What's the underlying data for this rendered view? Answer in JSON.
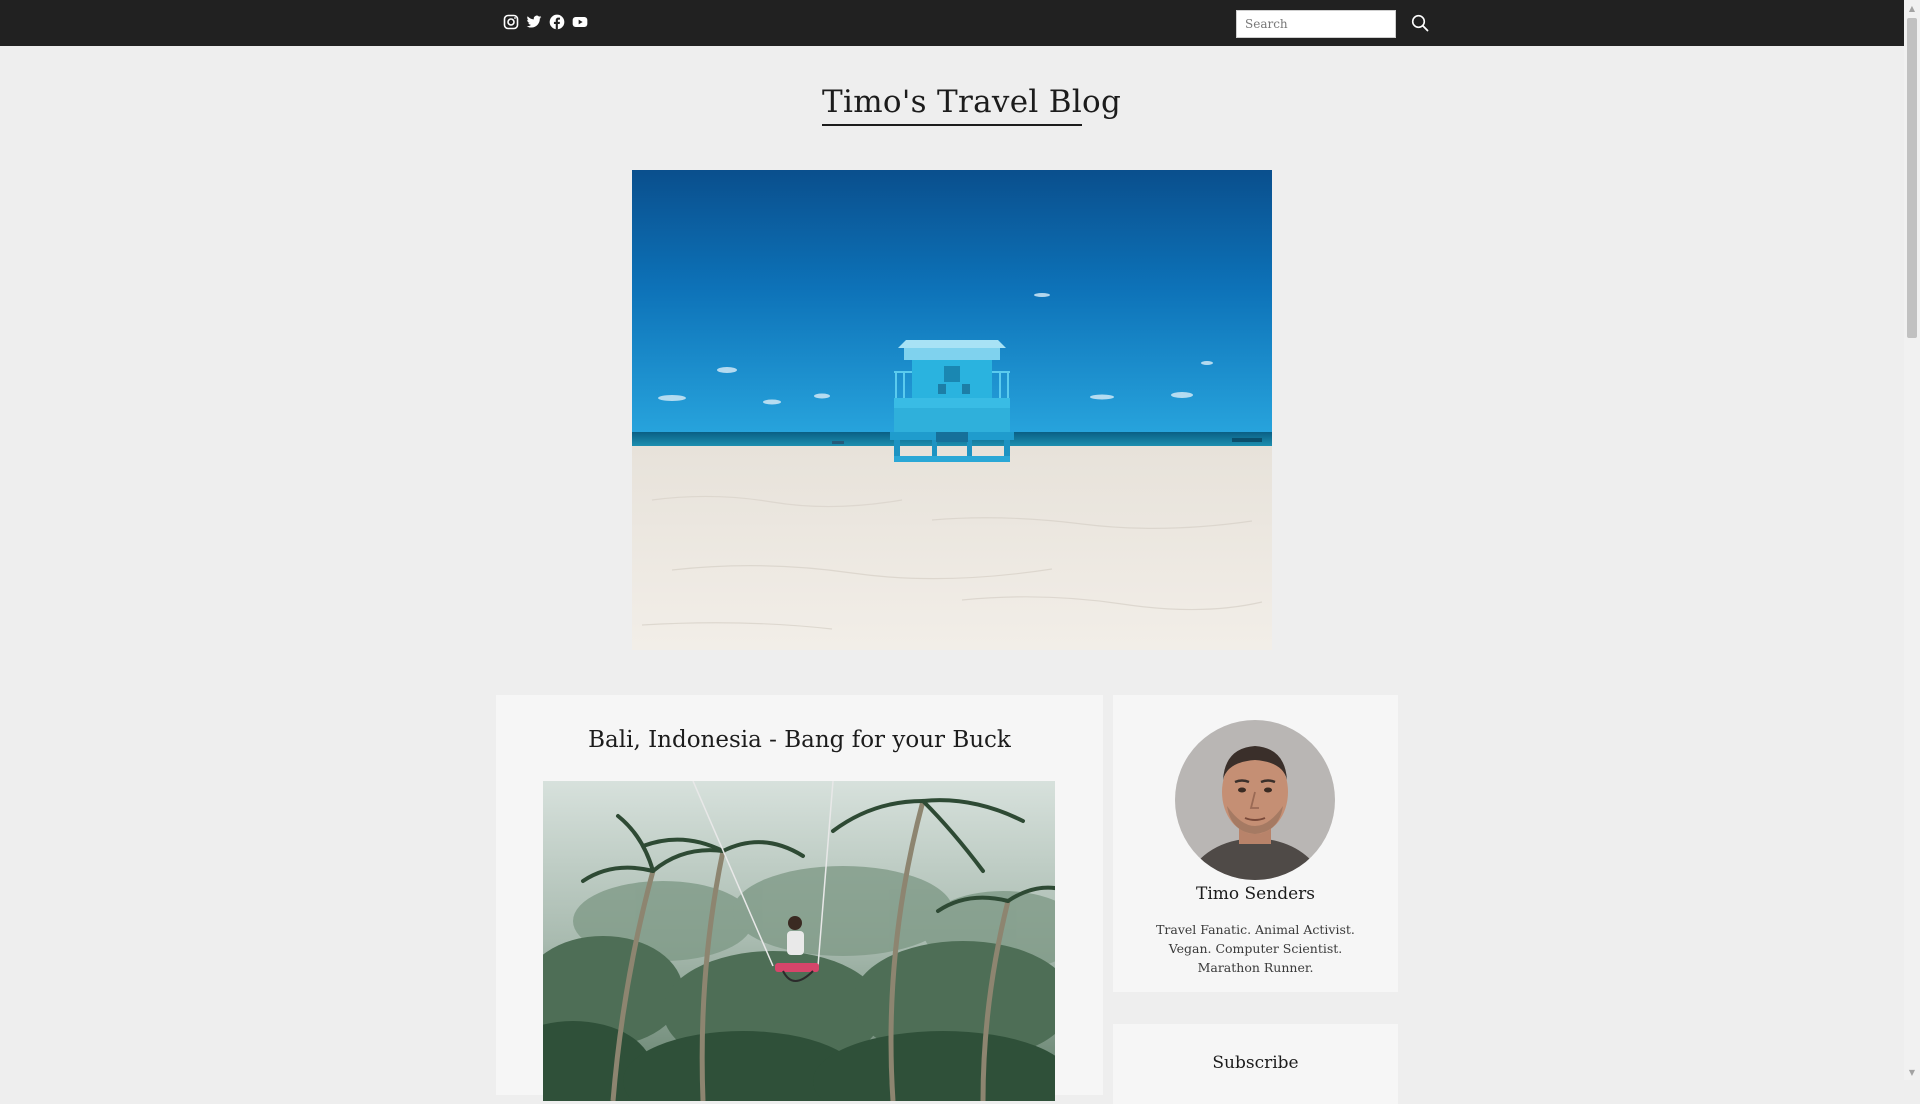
{
  "topbar": {
    "social_icons": [
      "instagram-icon",
      "twitter-icon",
      "facebook-icon",
      "youtube-icon"
    ],
    "search": {
      "placeholder": "Search",
      "value": ""
    },
    "search_icon": "search-icon"
  },
  "header": {
    "title": "Timo's Travel Blog"
  },
  "hero": {
    "alt": "Blue lifeguard tower on a white sand beach under a deep blue sky"
  },
  "post": {
    "title": "Bali, Indonesia - Bang for your Buck",
    "image_alt": "Person on a swing above a tropical jungle in Bali"
  },
  "sidebar": {
    "profile": {
      "name": "Timo Senders",
      "bio": "Travel Fanatic. Animal Activist. Vegan. Computer Scientist. Marathon Runner."
    },
    "subscribe": {
      "title": "Subscribe"
    }
  },
  "colors": {
    "topbar": "#212121",
    "page_background": "#eeeeee",
    "card_background": "#f6f6f6",
    "text": "#1c1c1c"
  }
}
